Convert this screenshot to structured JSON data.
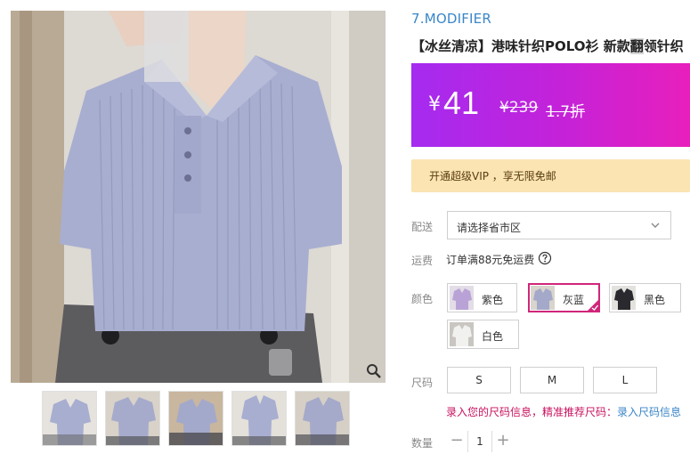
{
  "product": {
    "brand": "7.MODIFIER",
    "title_pre": "【冰丝清凉】港味针织POLO衫 新款",
    "title_hl": "翻",
    "title_post": "领针织"
  },
  "price": {
    "currency": "¥",
    "current": "41",
    "original": "¥239",
    "discount": "1.7折"
  },
  "vip": {
    "text": "开通超级VIP ，享无限免邮"
  },
  "shipping": {
    "label": "配送",
    "select_value": "请选择省市区",
    "freight_label": "运费",
    "freight_text": "订单满88元免运费"
  },
  "colors": {
    "label": "颜色",
    "options": [
      {
        "label": "紫色",
        "selected": false,
        "swatch": "#b9a3d6"
      },
      {
        "label": "灰蓝",
        "selected": true,
        "swatch": "#a4a9c9"
      },
      {
        "label": "黑色",
        "selected": false,
        "swatch": "#2a2a2e"
      },
      {
        "label": "白色",
        "selected": false,
        "swatch": "#eeeeec"
      }
    ]
  },
  "sizes": {
    "label": "尺码",
    "options": [
      "S",
      "M",
      "L"
    ],
    "hint_text": "录入您的尺码信息，精准推荐尺码：",
    "hint_link": "录入尺码信息"
  },
  "quantity": {
    "label": "数量",
    "value": "1",
    "minus": "−",
    "plus": "+"
  },
  "gallery": {
    "thumbnail_count": 5
  },
  "colors_theme": {
    "accent": "#d0267a",
    "brand_blue": "#3a86c8",
    "price_gradient_start": "#a52bf0",
    "price_gradient_end": "#e81fbc",
    "vip_bg": "#fbe3b2"
  }
}
